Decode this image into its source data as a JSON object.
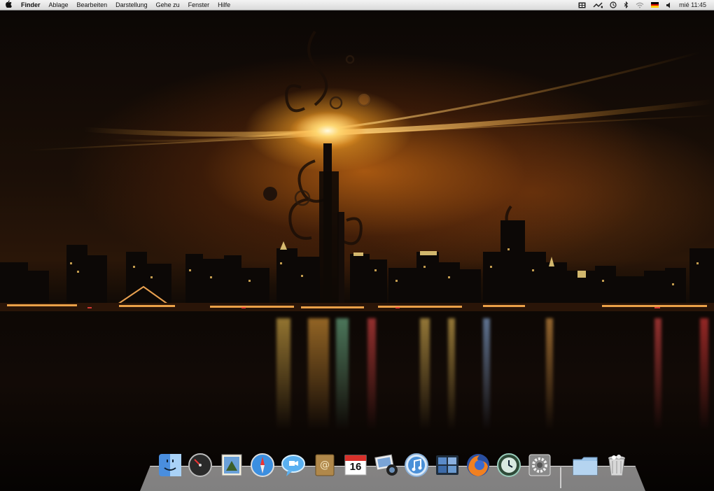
{
  "menubar": {
    "apple_icon": "apple-icon",
    "items": [
      "Finder",
      "Ablage",
      "Bearbeiten",
      "Darstellung",
      "Gehe zu",
      "Fenster",
      "Hilfe"
    ],
    "clock": "mié 11:45",
    "extras": [
      "spaces-icon",
      "sync-icon",
      "time-machine-icon",
      "bluetooth-icon",
      "wifi-icon",
      "flag-de-icon",
      "volume-icon"
    ]
  },
  "dock": {
    "items": [
      {
        "name": "finder-icon"
      },
      {
        "name": "dashboard-icon"
      },
      {
        "name": "mail-stamp-icon"
      },
      {
        "name": "safari-icon"
      },
      {
        "name": "ichat-icon"
      },
      {
        "name": "address-book-icon"
      },
      {
        "name": "ical-icon",
        "label": "16"
      },
      {
        "name": "iphoto-icon"
      },
      {
        "name": "itunes-icon"
      },
      {
        "name": "spaces-icon"
      },
      {
        "name": "firefox-icon"
      },
      {
        "name": "time-machine-icon"
      },
      {
        "name": "system-preferences-icon"
      },
      {
        "name": "folder-icon"
      },
      {
        "name": "trash-icon"
      }
    ]
  },
  "colors": {
    "menubar": "#e6e6e6",
    "glow": "#ffb43a"
  }
}
